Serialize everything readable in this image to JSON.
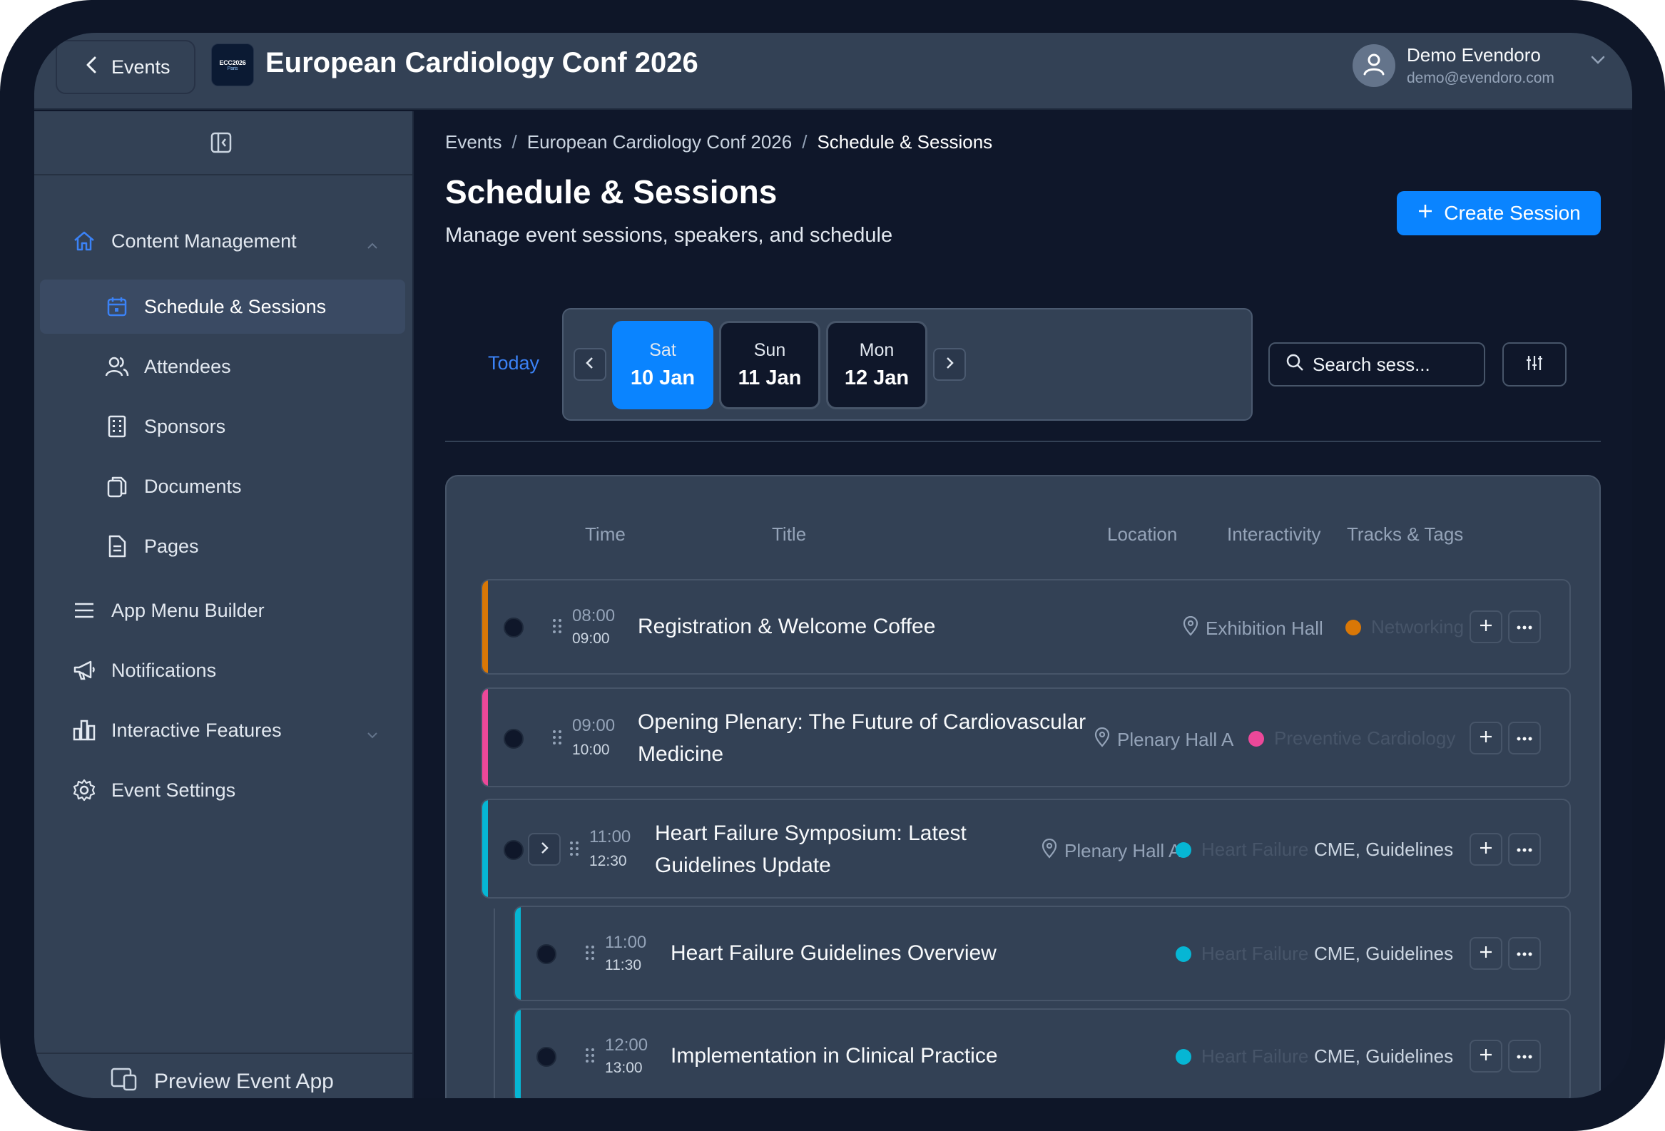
{
  "header": {
    "back_label": "Events",
    "logo_text": "ECC2026",
    "logo_sub": "Paris",
    "event_title": "European Cardiology Conf 2026",
    "user_name": "Demo Evendoro",
    "user_email": "demo@evendoro.com"
  },
  "sidebar": {
    "items": [
      {
        "label": "Content Management",
        "icon": "home-icon"
      },
      {
        "label": "Schedule & Sessions",
        "icon": "calendar-icon"
      },
      {
        "label": "Attendees",
        "icon": "users-icon"
      },
      {
        "label": "Sponsors",
        "icon": "building-icon"
      },
      {
        "label": "Documents",
        "icon": "files-icon"
      },
      {
        "label": "Pages",
        "icon": "file-text-icon"
      },
      {
        "label": "App Menu Builder",
        "icon": "menu-icon"
      },
      {
        "label": "Notifications",
        "icon": "megaphone-icon"
      },
      {
        "label": "Interactive Features",
        "icon": "bar-chart-icon"
      },
      {
        "label": "Event Settings",
        "icon": "gear-icon"
      }
    ],
    "preview_label": "Preview Event App"
  },
  "breadcrumb": [
    "Events",
    "European Cardiology Conf 2026",
    "Schedule & Sessions"
  ],
  "page": {
    "title": "Schedule & Sessions",
    "subtitle": "Manage event sessions, speakers, and schedule",
    "create_label": "Create Session"
  },
  "dates": {
    "today_label": "Today",
    "days": [
      {
        "dow": "Sat",
        "date": "10 Jan",
        "selected": true
      },
      {
        "dow": "Sun",
        "date": "11 Jan",
        "selected": false
      },
      {
        "dow": "Mon",
        "date": "12 Jan",
        "selected": false
      }
    ]
  },
  "search": {
    "placeholder": "Search sess..."
  },
  "table": {
    "columns": [
      "Time",
      "Title",
      "Location",
      "Interactivity",
      "Tracks & Tags"
    ],
    "rows": [
      {
        "start": "08:00",
        "end": "09:00",
        "title": "Registration & Welcome Coffee",
        "location": "Exhibition Hall",
        "track": "Networking",
        "track_color": "#d97706",
        "tags": ""
      },
      {
        "start": "09:00",
        "end": "10:00",
        "title_line1": "Opening Plenary: The Future of Cardiovascular",
        "title_line2": "Medicine",
        "location": "Plenary Hall A",
        "track": "Preventive Cardiology",
        "track_color": "#ec4899",
        "tags": ""
      },
      {
        "start": "11:00",
        "end": "12:30",
        "title_line1": "Heart Failure Symposium: Latest",
        "title_line2": "Guidelines Update",
        "location": "Plenary Hall A",
        "track": "Heart Failure",
        "track_color": "#06b6d4",
        "tags": "CME, Guidelines"
      },
      {
        "start": "11:00",
        "end": "11:30",
        "title": "Heart Failure Guidelines Overview",
        "location": "",
        "track": "Heart Failure",
        "track_color": "#06b6d4",
        "tags": "CME, Guidelines"
      },
      {
        "start": "12:00",
        "end": "13:00",
        "title": "Implementation in Clinical Practice",
        "location": "",
        "track": "Heart Failure",
        "track_color": "#06b6d4",
        "tags": "CME, Guidelines"
      }
    ]
  },
  "colors": {
    "accent": "#0a84ff",
    "background": "#0f172a",
    "panel": "#334155"
  }
}
